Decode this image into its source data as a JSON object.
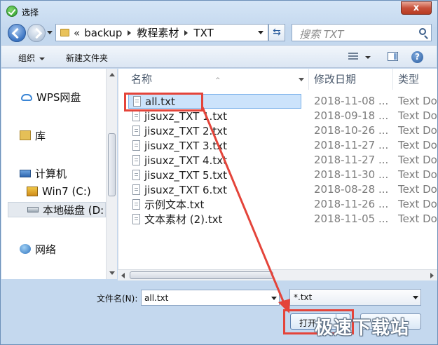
{
  "window": {
    "title": "选择",
    "close_label": "x"
  },
  "address": {
    "overflow": "«",
    "crumbs": [
      "backup",
      "教程素材",
      "TXT"
    ]
  },
  "search": {
    "placeholder": "搜索 TXT"
  },
  "toolbar": {
    "organize": "组织",
    "new_folder": "新建文件夹",
    "help": "?"
  },
  "nav": {
    "items": [
      {
        "label": "WPS网盘",
        "icon": "cloud-icon"
      },
      {
        "label": "库",
        "icon": "library-icon"
      },
      {
        "label": "计算机",
        "icon": "computer-icon"
      },
      {
        "label": "Win7 (C:)",
        "icon": "windows-drive-icon"
      },
      {
        "label": "本地磁盘 (D:",
        "icon": "drive-icon",
        "selected": true
      },
      {
        "label": "网络",
        "icon": "network-icon"
      }
    ]
  },
  "columns": {
    "name": "名称",
    "date": "修改日期",
    "type": "类型"
  },
  "files": [
    {
      "name": "all.txt",
      "date": "2018-11-08 ...",
      "type": "Text Do",
      "selected": true
    },
    {
      "name": "jisuxz_TXT 1.txt",
      "date": "2018-09-18 ...",
      "type": "Text Do"
    },
    {
      "name": "jisuxz_TXT 2.txt",
      "date": "2018-10-26 ...",
      "type": "Text Do"
    },
    {
      "name": "jisuxz_TXT 3.txt",
      "date": "2018-11-27 ...",
      "type": "Text Do"
    },
    {
      "name": "jisuxz_TXT 4.txt",
      "date": "2018-11-27 ...",
      "type": "Text Do"
    },
    {
      "name": "jisuxz_TXT 5.txt",
      "date": "2018-11-30 ...",
      "type": "Text Do"
    },
    {
      "name": "jisuxz_TXT 6.txt",
      "date": "2018-08-28 ...",
      "type": "Text Do"
    },
    {
      "name": "示例文本.txt",
      "date": "2018-11-26 ...",
      "type": "Text Do"
    },
    {
      "name": "文本素材 (2).txt",
      "date": "2018-11-05 ...",
      "type": "Text Do"
    }
  ],
  "footer": {
    "filename_label": "文件名(N):",
    "filename_value": "all.txt",
    "filter_value": "*.txt",
    "open_label": "打开(O)"
  },
  "watermark": "极速下载站",
  "colors": {
    "annotation": "#e4443a",
    "selection": "#cce3fb"
  }
}
